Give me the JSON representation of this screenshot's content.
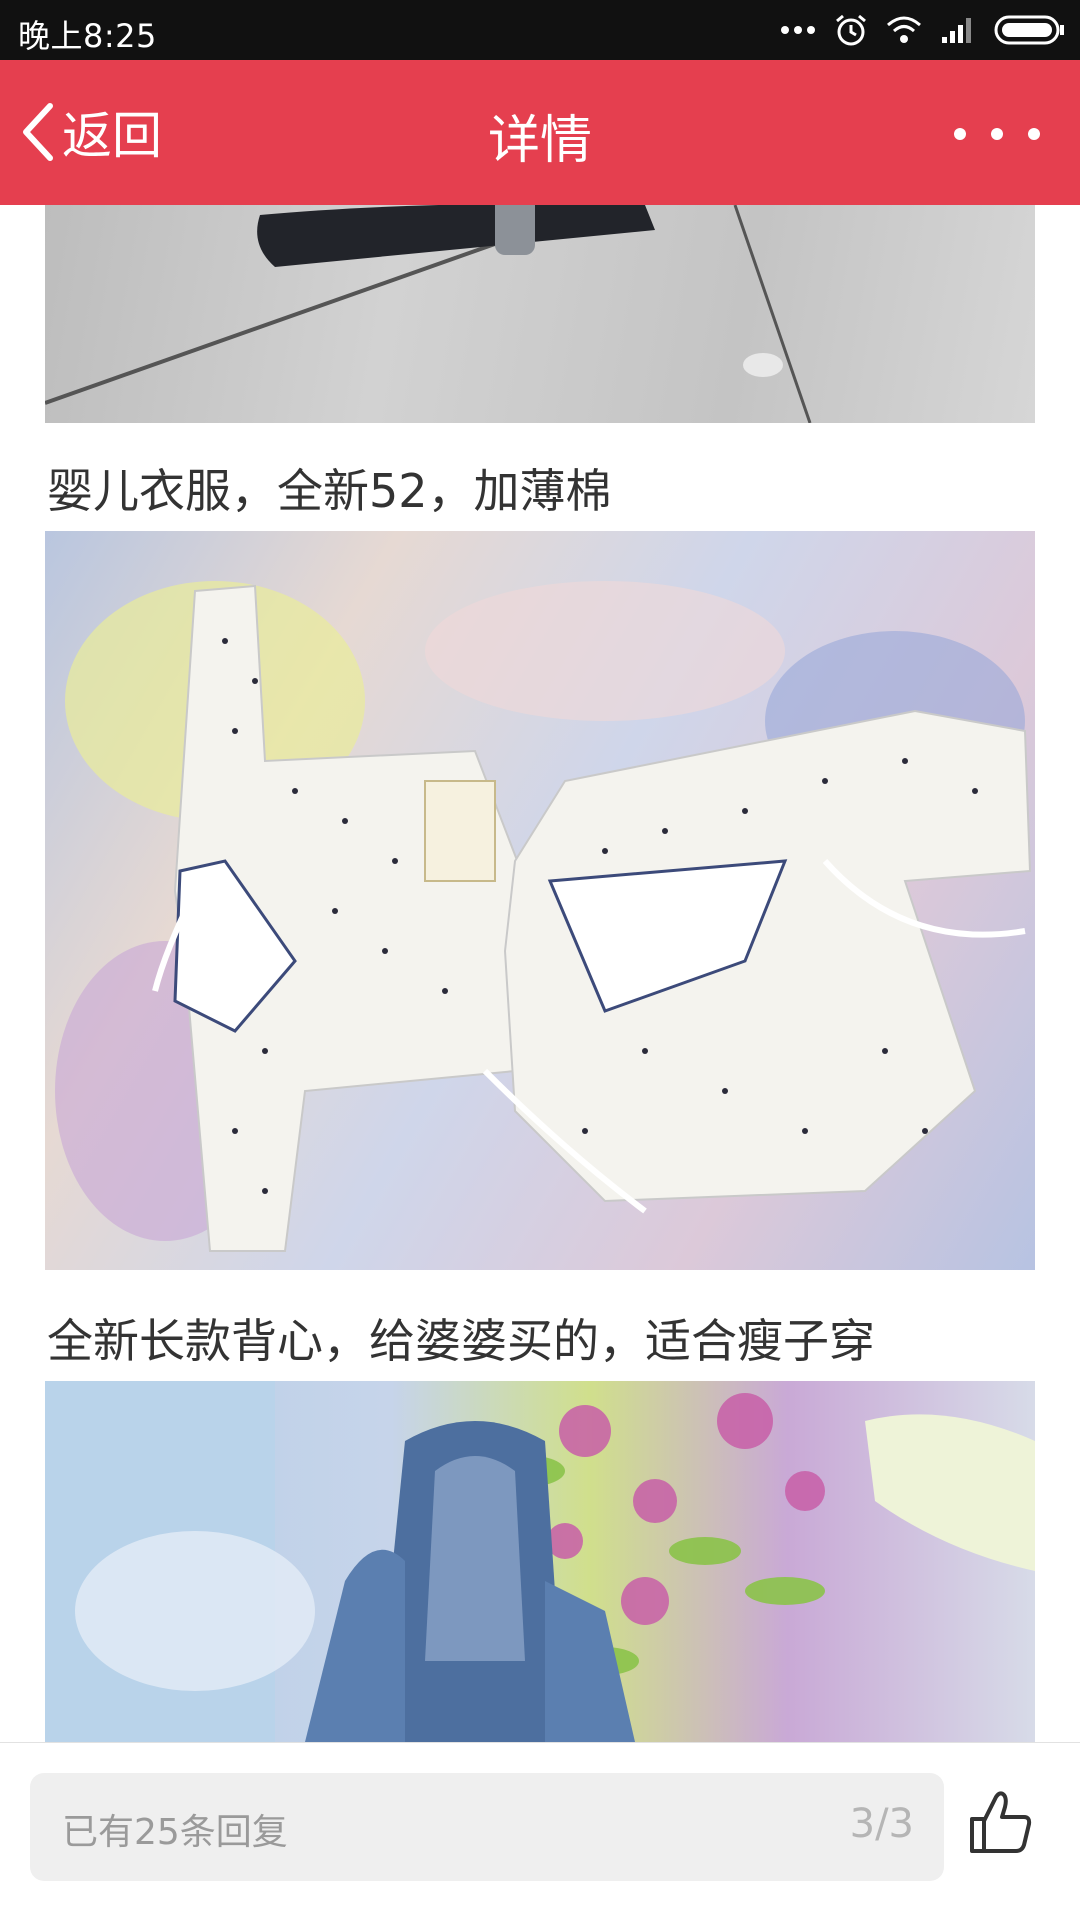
{
  "status_bar": {
    "time": "晚上8:25",
    "icons": [
      "more-dots-icon",
      "alarm-icon",
      "wifi-icon",
      "signal-icon",
      "battery-icon"
    ]
  },
  "nav": {
    "back_label": "返回",
    "title": "详情",
    "more_icon": "more-icon",
    "background_color": "#e53f4f"
  },
  "posts": [
    {
      "caption": "婴儿衣服，全新52，加薄棉"
    },
    {
      "caption": "全新长款背心，给婆婆买的，适合瘦子穿"
    }
  ],
  "bottom_bar": {
    "reply_text": "已有25条回复",
    "page_indicator": "3/3",
    "like_icon": "thumbs-up-icon"
  }
}
